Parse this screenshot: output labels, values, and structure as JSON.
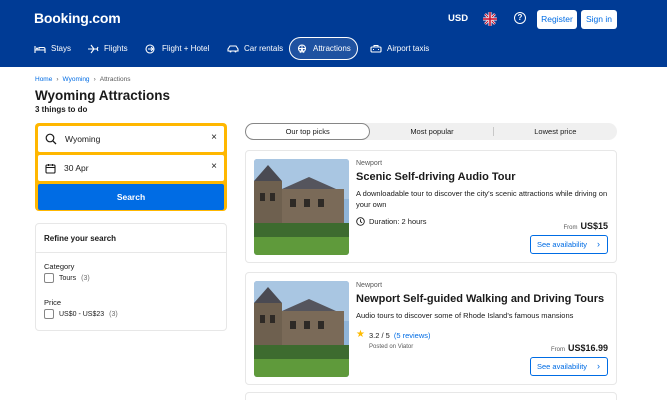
{
  "header": {
    "logo": "Booking.com",
    "currency": "USD",
    "help_icon": "?",
    "register_label": "Register",
    "signin_label": "Sign in",
    "brand_color": "#003b95",
    "accent_color": "#006ce4",
    "nav": [
      {
        "label": "Stays",
        "icon": "bed-icon"
      },
      {
        "label": "Flights",
        "icon": "plane-icon"
      },
      {
        "label": "Flight + Hotel",
        "icon": "flight-hotel-icon"
      },
      {
        "label": "Car rentals",
        "icon": "car-icon"
      },
      {
        "label": "Attractions",
        "icon": "ferris-wheel-icon",
        "active": true
      },
      {
        "label": "Airport taxis",
        "icon": "taxi-icon"
      }
    ]
  },
  "breadcrumb": [
    "Home",
    "Wyoming",
    "Attractions"
  ],
  "page": {
    "title": "Wyoming Attractions",
    "subtitle": "3 things to do"
  },
  "search": {
    "destination": "Wyoming",
    "date": "30 Apr",
    "clear_icon": "×",
    "button_label": "Search",
    "border_color": "#ffb700"
  },
  "refine": {
    "title": "Refine your search",
    "category_label": "Category",
    "category_option": "Tours",
    "category_count": "(3)",
    "price_label": "Price",
    "price_option": "US$0 - US$23",
    "price_count": "(3)"
  },
  "sort_tabs": [
    "Our top picks",
    "Most popular",
    "Lowest price"
  ],
  "results": [
    {
      "location": "Newport",
      "title": "Scenic Self-driving Audio Tour",
      "description": "A downloadable tour to discover the city's scenic attractions while driving on your own",
      "duration": "Duration: 2 hours",
      "price_from": "From",
      "price": "US$15",
      "button_label": "See availability",
      "chevron": "›"
    },
    {
      "location": "Newport",
      "title": "Newport Self-guided Walking and Driving Tours",
      "description": "Audio tours to discover some of Rhode Island's famous mansions",
      "rating": "3.2 / 5",
      "reviews": "(5 reviews)",
      "posted": "Posted on Viator",
      "star": "★",
      "price_from": "From",
      "price": "US$16.99",
      "button_label": "See availability",
      "chevron": "›"
    }
  ]
}
